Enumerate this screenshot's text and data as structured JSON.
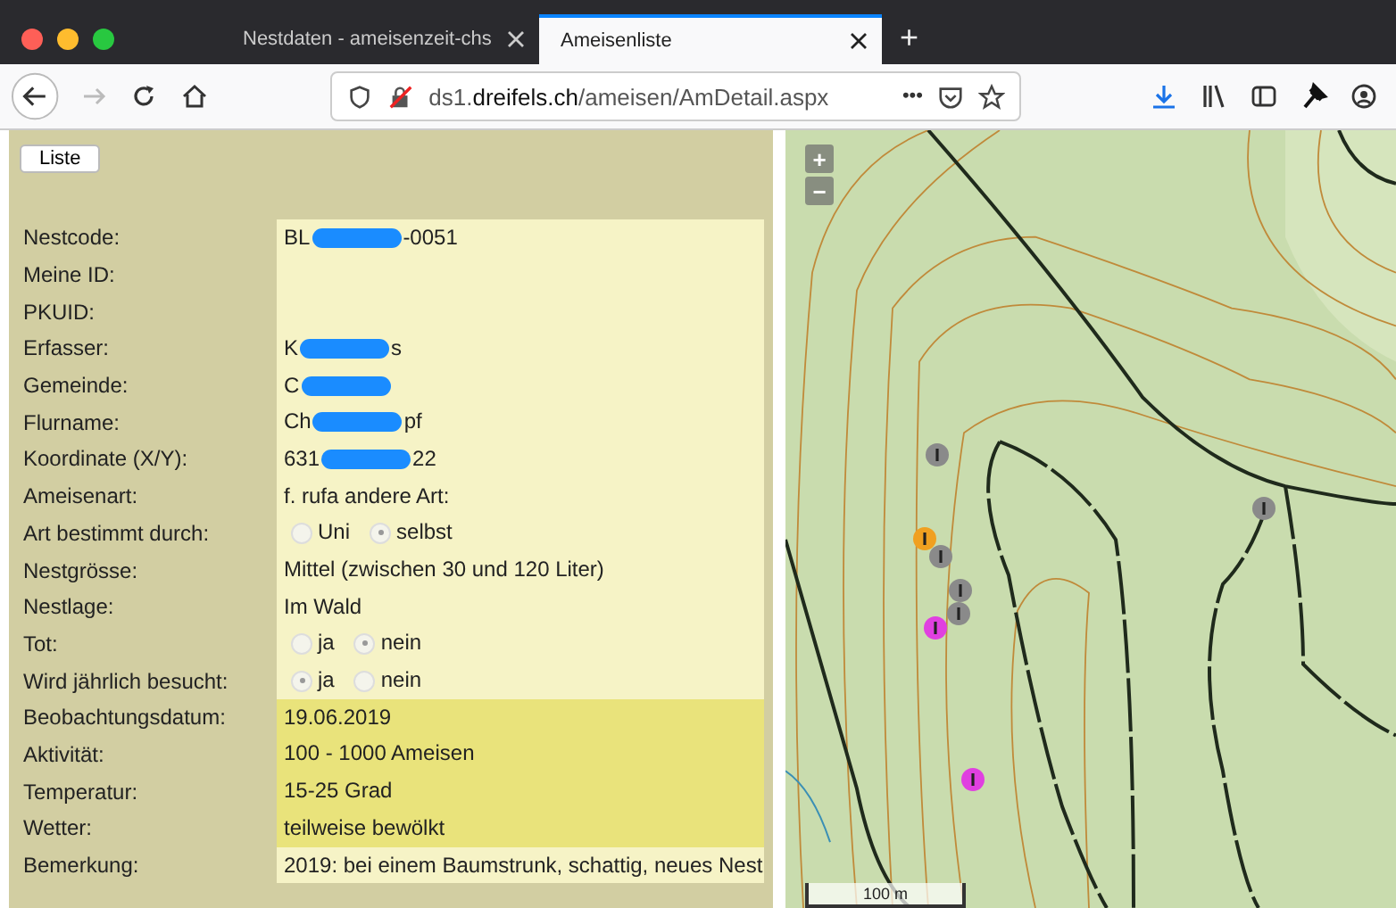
{
  "browser": {
    "tabs": [
      {
        "title": "Nestdaten - ameisenzeit-chs",
        "selected": false
      },
      {
        "title": "Ameisenliste",
        "selected": true
      }
    ],
    "new_tab": "+",
    "url": {
      "host_prefix": "ds1.",
      "host": "dreifels.ch",
      "path": "/ameisen/AmDetail.aspx"
    },
    "more": "•••"
  },
  "list_button": "Liste",
  "rows": [
    {
      "label": "Nestcode:",
      "kind": "redacted",
      "before": "BL",
      "after": "-0051",
      "highlighted": false
    },
    {
      "label": "Meine ID:",
      "kind": "text",
      "highlighted": false
    },
    {
      "label": "PKUID:",
      "kind": "text",
      "highlighted": false
    },
    {
      "label": "Erfasser:",
      "kind": "redacted",
      "before": "K",
      "after": "s",
      "highlighted": false
    },
    {
      "label": "Gemeinde:",
      "kind": "redacted",
      "before": "C",
      "highlighted": false
    },
    {
      "label": "Flurname:",
      "kind": "redacted",
      "before": "Ch",
      "after": "pf",
      "highlighted": false
    },
    {
      "label": "Koordinate (X/Y):",
      "kind": "redacted",
      "before": "631",
      "after": "22",
      "highlighted": false
    },
    {
      "label": "Ameisenart:",
      "kind": "text",
      "value": "f. rufa  andere Art:",
      "highlighted": false
    },
    {
      "label": "Art bestimmt durch:",
      "kind": "radio",
      "options": [
        {
          "label": "Uni",
          "selected": false
        },
        {
          "label": "selbst",
          "selected": true
        }
      ],
      "highlighted": false
    },
    {
      "label": "Nestgrösse:",
      "kind": "text",
      "value": "Mittel (zwischen 30 und 120 Liter)",
      "highlighted": false
    },
    {
      "label": "Nestlage:",
      "kind": "text",
      "value": "Im Wald",
      "highlighted": false
    },
    {
      "label": "Tot:",
      "kind": "radio",
      "options": [
        {
          "label": "ja",
          "selected": false
        },
        {
          "label": "nein",
          "selected": true
        }
      ],
      "highlighted": false
    },
    {
      "label": "Wird jährlich besucht:",
      "kind": "radio",
      "options": [
        {
          "label": "ja",
          "selected": true
        },
        {
          "label": "nein",
          "selected": false
        }
      ],
      "highlighted": false
    },
    {
      "label": "Beobachtungsdatum:",
      "kind": "text",
      "value": "19.06.2019",
      "highlighted": true
    },
    {
      "label": "Aktivität:",
      "kind": "text",
      "value": "100 - 1000 Ameisen",
      "highlighted": true
    },
    {
      "label": "Temperatur:",
      "kind": "text",
      "value": "15-25 Grad",
      "highlighted": true
    },
    {
      "label": "Wetter:",
      "kind": "text",
      "value": "teilweise bewölkt",
      "highlighted": true
    },
    {
      "label": "Bemerkung:",
      "kind": "text",
      "value": "2019: bei einem Baumstrunk, schattig, neues Nest",
      "highlighted": false
    }
  ],
  "map": {
    "kind": "picture",
    "zoom_in": "+",
    "zoom_out": "−",
    "scale": "100 m",
    "markers": [
      {
        "color": "#8a8a8a"
      },
      {
        "color": "#f0a020"
      },
      {
        "color": "#8a8a8a"
      },
      {
        "color": "#8a8a8a"
      },
      {
        "color": "#8a8a8a"
      },
      {
        "color": "#e040e0"
      },
      {
        "color": "#8a8a8a"
      },
      {
        "color": "#e040e0"
      }
    ]
  }
}
